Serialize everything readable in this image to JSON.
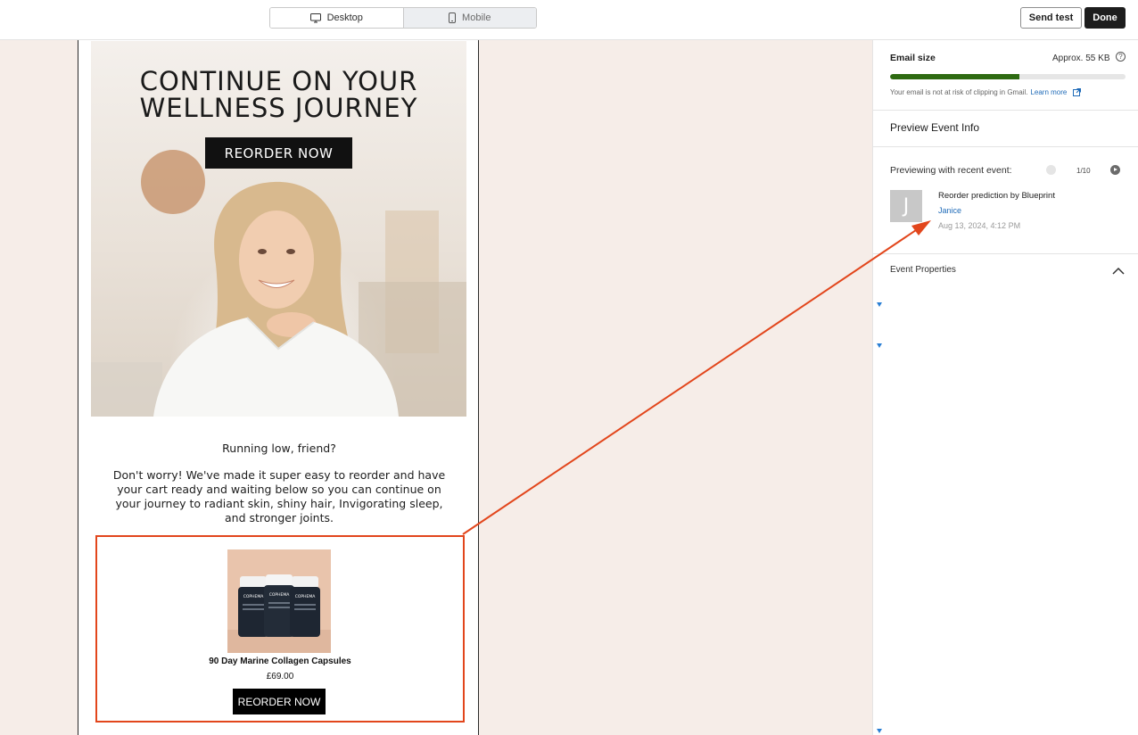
{
  "toolbar": {
    "desktop_label": "Desktop",
    "mobile_label": "Mobile",
    "send_test_label": "Send test",
    "done_label": "Done"
  },
  "email": {
    "hero_title_line1": "CONTINUE ON YOUR",
    "hero_title_line2": "WELLNESS JOURNEY",
    "hero_cta": "REORDER NOW",
    "greeting": "Running low, friend?",
    "body": "Don't worry! We've made it super easy to reorder and have your cart ready and waiting below so you can continue on your journey to radiant skin, shiny hair, Invigorating sleep, and stronger joints.",
    "product": {
      "name": "90 Day Marine Collagen Capsules",
      "price": "£69.00",
      "cta": "REORDER NOW",
      "bottle_brand": "COPHEMA"
    }
  },
  "panel": {
    "email_size_label": "Email size",
    "email_size_value": "Approx. 55 KB",
    "email_size_fraction": 0.55,
    "clip_note": "Your email is not at risk of clipping in Gmail.",
    "learn_more": "Learn more",
    "section_title": "Preview Event Info",
    "previewing_label": "Previewing with recent event:",
    "pager": "1/10",
    "avatar_letter": "J",
    "event_title": "Reorder prediction by Blueprint",
    "event_person": "Janice",
    "event_time": "Aug 13, 2024, 4:12 PM",
    "event_properties_label": "Event Properties"
  },
  "colors": {
    "canvas_bg": "#f6ede8",
    "highlight": "#e2461c",
    "progress": "#2e6b12",
    "link": "#1f6bb8"
  },
  "icons": [
    "monitor-icon",
    "phone-icon",
    "help-circle-icon",
    "external-link-icon",
    "chevron-up-icon",
    "chevron-right-icon"
  ]
}
